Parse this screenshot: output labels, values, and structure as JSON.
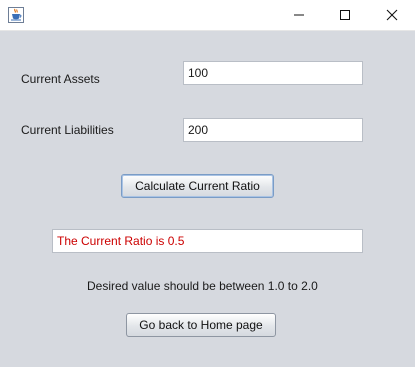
{
  "window": {
    "icon": "java-coffee-cup-icon",
    "controls": {
      "minimize_icon": "minimize-icon",
      "maximize_icon": "maximize-icon",
      "close_icon": "close-icon"
    }
  },
  "form": {
    "current_assets": {
      "label": "Current Assets",
      "value": "100"
    },
    "current_liabilities": {
      "label": "Current Liabilities",
      "value": "200"
    },
    "calculate_button": "Calculate Current Ratio",
    "result_text": "The Current Ratio is 0.5",
    "hint_text": "Desired value should be between 1.0 to 2.0",
    "home_button": "Go back to Home page"
  },
  "colors": {
    "result_text": "#cc0000",
    "background": "#d6d9df",
    "focus_border": "#7a9cc6"
  }
}
